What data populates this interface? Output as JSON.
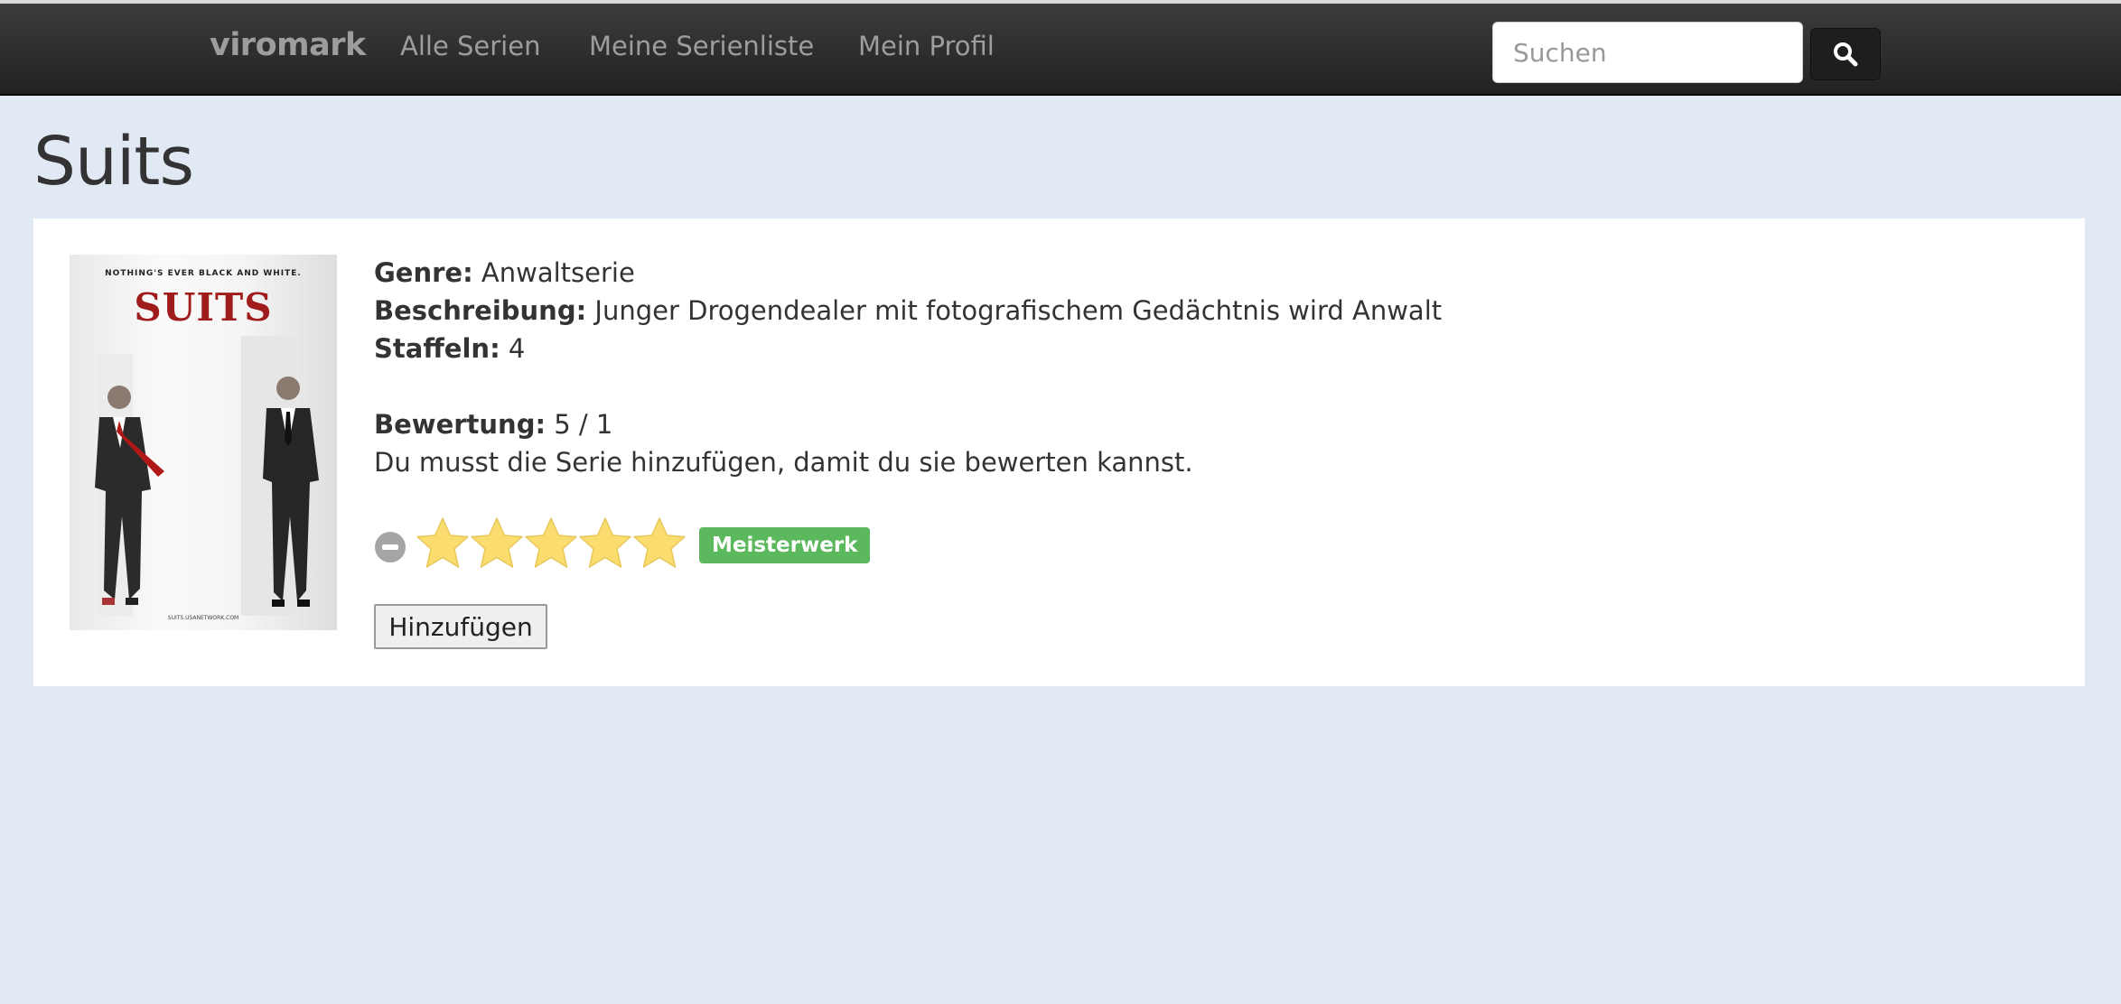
{
  "navbar": {
    "brand": "viromark",
    "links": [
      "Alle Serien",
      "Meine Serienliste",
      "Mein Profil"
    ],
    "search_placeholder": "Suchen"
  },
  "page": {
    "title": "Suits"
  },
  "series": {
    "poster": {
      "tagline": "NOTHING'S EVER BLACK AND WHITE.",
      "title": "SUITS",
      "footer": "SUITS.USANETWORK.COM"
    },
    "genre_label": "Genre:",
    "genre": "Anwaltserie",
    "description_label": "Beschreibung:",
    "description": "Junger Drogendealer mit fotografischem Gedächtnis wird Anwalt",
    "seasons_label": "Staffeln:",
    "seasons": "4",
    "rating_label": "Bewertung:",
    "rating": "5 / 1",
    "hint": "Du musst die Serie hinzufügen, damit du sie bewerten kannst.",
    "stars_filled": 5,
    "stars_total": 5,
    "rating_badge": "Meisterwerk",
    "add_button": "Hinzufügen"
  },
  "colors": {
    "navbar": "#222222",
    "background": "#e1eaf4",
    "badge": "#5cb85c",
    "star": "#fbdc6f"
  }
}
